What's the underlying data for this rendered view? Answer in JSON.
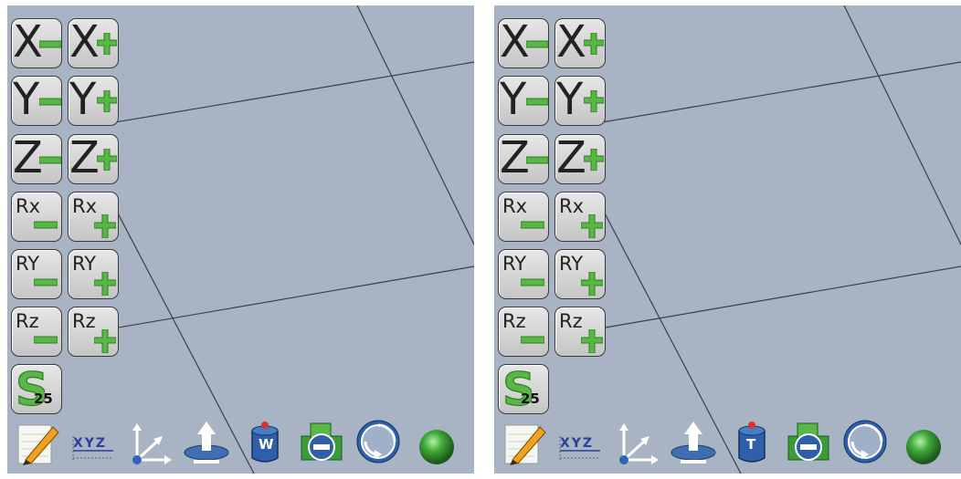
{
  "left_panel": {
    "jog_buttons": [
      {
        "row": "x",
        "minus": "X",
        "plus": "X"
      },
      {
        "row": "y",
        "minus": "Y",
        "plus": "Y"
      },
      {
        "row": "z",
        "minus": "Z",
        "plus": "Z"
      }
    ],
    "rot_buttons": [
      {
        "row": "rx",
        "minus": "Rx",
        "plus": "Rx"
      },
      {
        "row": "ry",
        "minus": "RY",
        "plus": "RY"
      },
      {
        "row": "rz",
        "minus": "Rz",
        "plus": "Rz"
      }
    ],
    "speed_button": {
      "letter": "S",
      "value": "25"
    },
    "toolbar": {
      "xyz_label": "XYZ",
      "frame_letter": "W"
    }
  },
  "right_panel": {
    "jog_buttons": [
      {
        "row": "x",
        "minus": "X",
        "plus": "X"
      },
      {
        "row": "y",
        "minus": "Y",
        "plus": "Y"
      },
      {
        "row": "z",
        "minus": "Z",
        "plus": "Z"
      }
    ],
    "rot_buttons": [
      {
        "row": "rx",
        "minus": "Rx",
        "plus": "Rx"
      },
      {
        "row": "ry",
        "minus": "RY",
        "plus": "RY"
      },
      {
        "row": "rz",
        "minus": "Rz",
        "plus": "Rz"
      }
    ],
    "speed_button": {
      "letter": "S",
      "value": "25"
    },
    "toolbar": {
      "xyz_label": "XYZ",
      "frame_letter": "T"
    }
  },
  "icons": [
    "edit-icon",
    "xyz-coordinates-icon",
    "axes-icon",
    "base-plane-icon",
    "frame-icon",
    "interference-icon",
    "rotate-view-icon",
    "status-lamp-icon"
  ],
  "colors": {
    "background": "#a8b4c4",
    "sign_green": "#58b845",
    "lamp_green": "#3faa3a",
    "frame_blue": "#2f5fa8"
  }
}
